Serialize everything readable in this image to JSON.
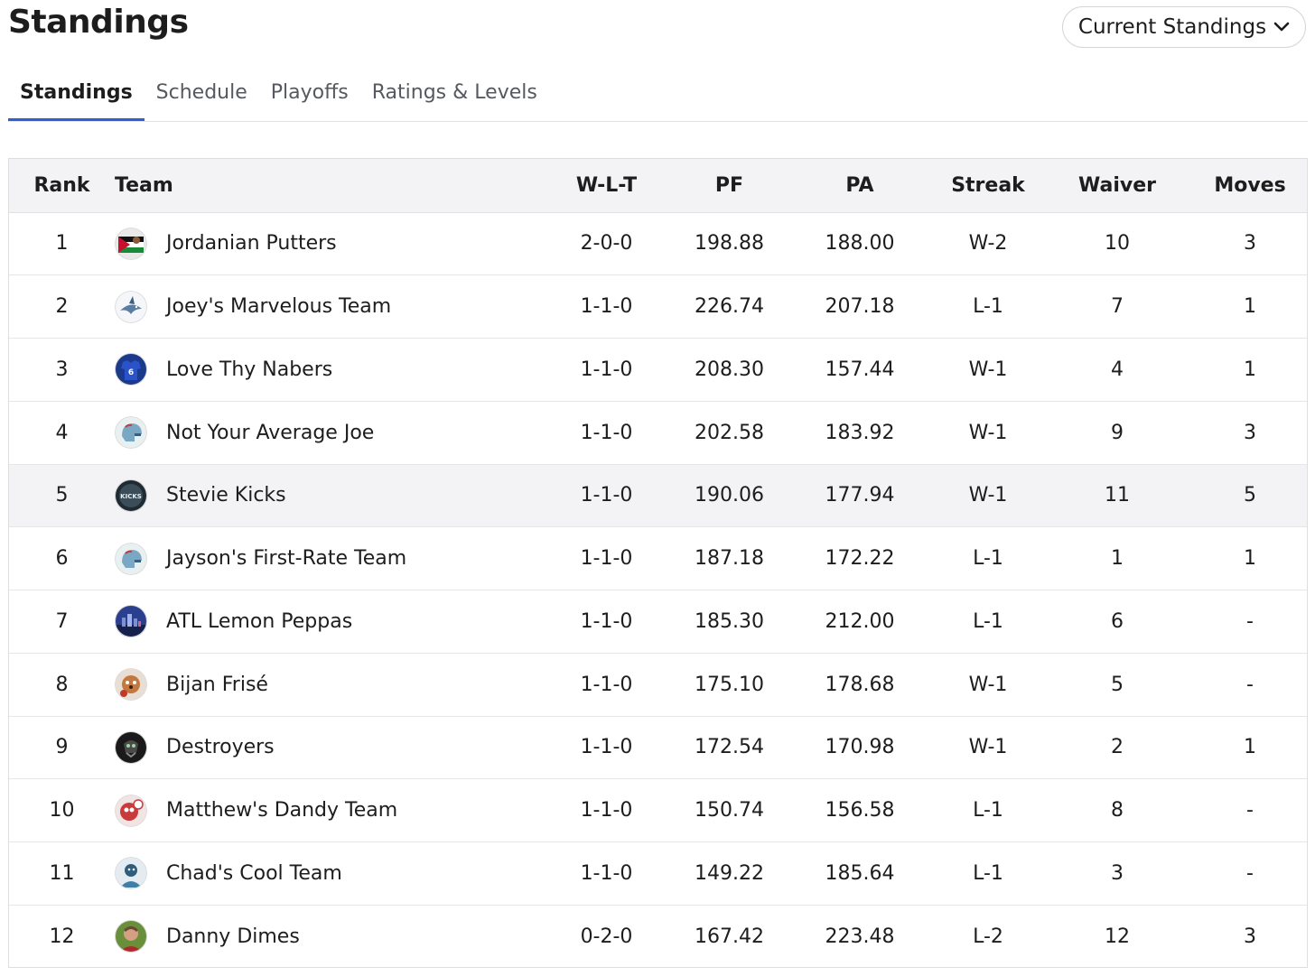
{
  "header": {
    "title": "Standings",
    "view_select": "Current Standings"
  },
  "tabs": [
    {
      "label": "Standings",
      "active": true
    },
    {
      "label": "Schedule",
      "active": false
    },
    {
      "label": "Playoffs",
      "active": false
    },
    {
      "label": "Ratings & Levels",
      "active": false
    }
  ],
  "table": {
    "columns": [
      "Rank",
      "Team",
      "W-L-T",
      "PF",
      "PA",
      "Streak",
      "Waiver",
      "Moves"
    ],
    "rows": [
      {
        "rank": "1",
        "team": "Jordanian Putters",
        "wlt": "2-0-0",
        "pf": "198.88",
        "pa": "188.00",
        "streak": "W-2",
        "waiver": "10",
        "moves": "3",
        "avatar": "jordan-flag-avatar"
      },
      {
        "rank": "2",
        "team": "Joey's Marvelous Team",
        "wlt": "1-1-0",
        "pf": "226.74",
        "pa": "207.18",
        "streak": "L-1",
        "waiver": "7",
        "moves": "1",
        "avatar": "shark-avatar"
      },
      {
        "rank": "3",
        "team": "Love Thy Nabers",
        "wlt": "1-1-0",
        "pf": "208.30",
        "pa": "157.44",
        "streak": "W-1",
        "waiver": "4",
        "moves": "1",
        "avatar": "jersey-avatar"
      },
      {
        "rank": "4",
        "team": "Not Your Average Joe",
        "wlt": "1-1-0",
        "pf": "202.58",
        "pa": "183.92",
        "streak": "W-1",
        "waiver": "9",
        "moves": "3",
        "avatar": "helmet-avatar"
      },
      {
        "rank": "5",
        "team": "Stevie Kicks",
        "wlt": "1-1-0",
        "pf": "190.06",
        "pa": "177.94",
        "streak": "W-1",
        "waiver": "11",
        "moves": "5",
        "avatar": "kicks-logo-avatar"
      },
      {
        "rank": "6",
        "team": "Jayson's First-Rate Team",
        "wlt": "1-1-0",
        "pf": "187.18",
        "pa": "172.22",
        "streak": "L-1",
        "waiver": "1",
        "moves": "1",
        "avatar": "helmet-avatar"
      },
      {
        "rank": "7",
        "team": "ATL Lemon Peppas",
        "wlt": "1-1-0",
        "pf": "185.30",
        "pa": "212.00",
        "streak": "L-1",
        "waiver": "6",
        "moves": "-",
        "avatar": "city-skyline-avatar"
      },
      {
        "rank": "8",
        "team": "Bijan Frisé",
        "wlt": "1-1-0",
        "pf": "175.10",
        "pa": "178.68",
        "streak": "W-1",
        "waiver": "5",
        "moves": "-",
        "avatar": "dog-avatar"
      },
      {
        "rank": "9",
        "team": "Destroyers",
        "wlt": "1-1-0",
        "pf": "172.54",
        "pa": "170.98",
        "streak": "W-1",
        "waiver": "2",
        "moves": "1",
        "avatar": "skull-avatar"
      },
      {
        "rank": "10",
        "team": "Matthew's Dandy Team",
        "wlt": "1-1-0",
        "pf": "150.74",
        "pa": "156.58",
        "streak": "L-1",
        "waiver": "8",
        "moves": "-",
        "avatar": "cartoon-avatar"
      },
      {
        "rank": "11",
        "team": "Chad's Cool Team",
        "wlt": "1-1-0",
        "pf": "149.22",
        "pa": "185.64",
        "streak": "L-1",
        "waiver": "3",
        "moves": "-",
        "avatar": "portrait-avatar"
      },
      {
        "rank": "12",
        "team": "Danny Dimes",
        "wlt": "0-2-0",
        "pf": "167.42",
        "pa": "223.48",
        "streak": "L-2",
        "waiver": "12",
        "moves": "3",
        "avatar": "player-photo-avatar"
      }
    ],
    "highlight_row": "5"
  },
  "colors": {
    "tab_underline": "#2a62d6",
    "header_bg": "#f3f3f5",
    "highlight_row_bg": "#f3f3f5",
    "text": "#1d1d1d",
    "muted_text": "#56595f"
  }
}
